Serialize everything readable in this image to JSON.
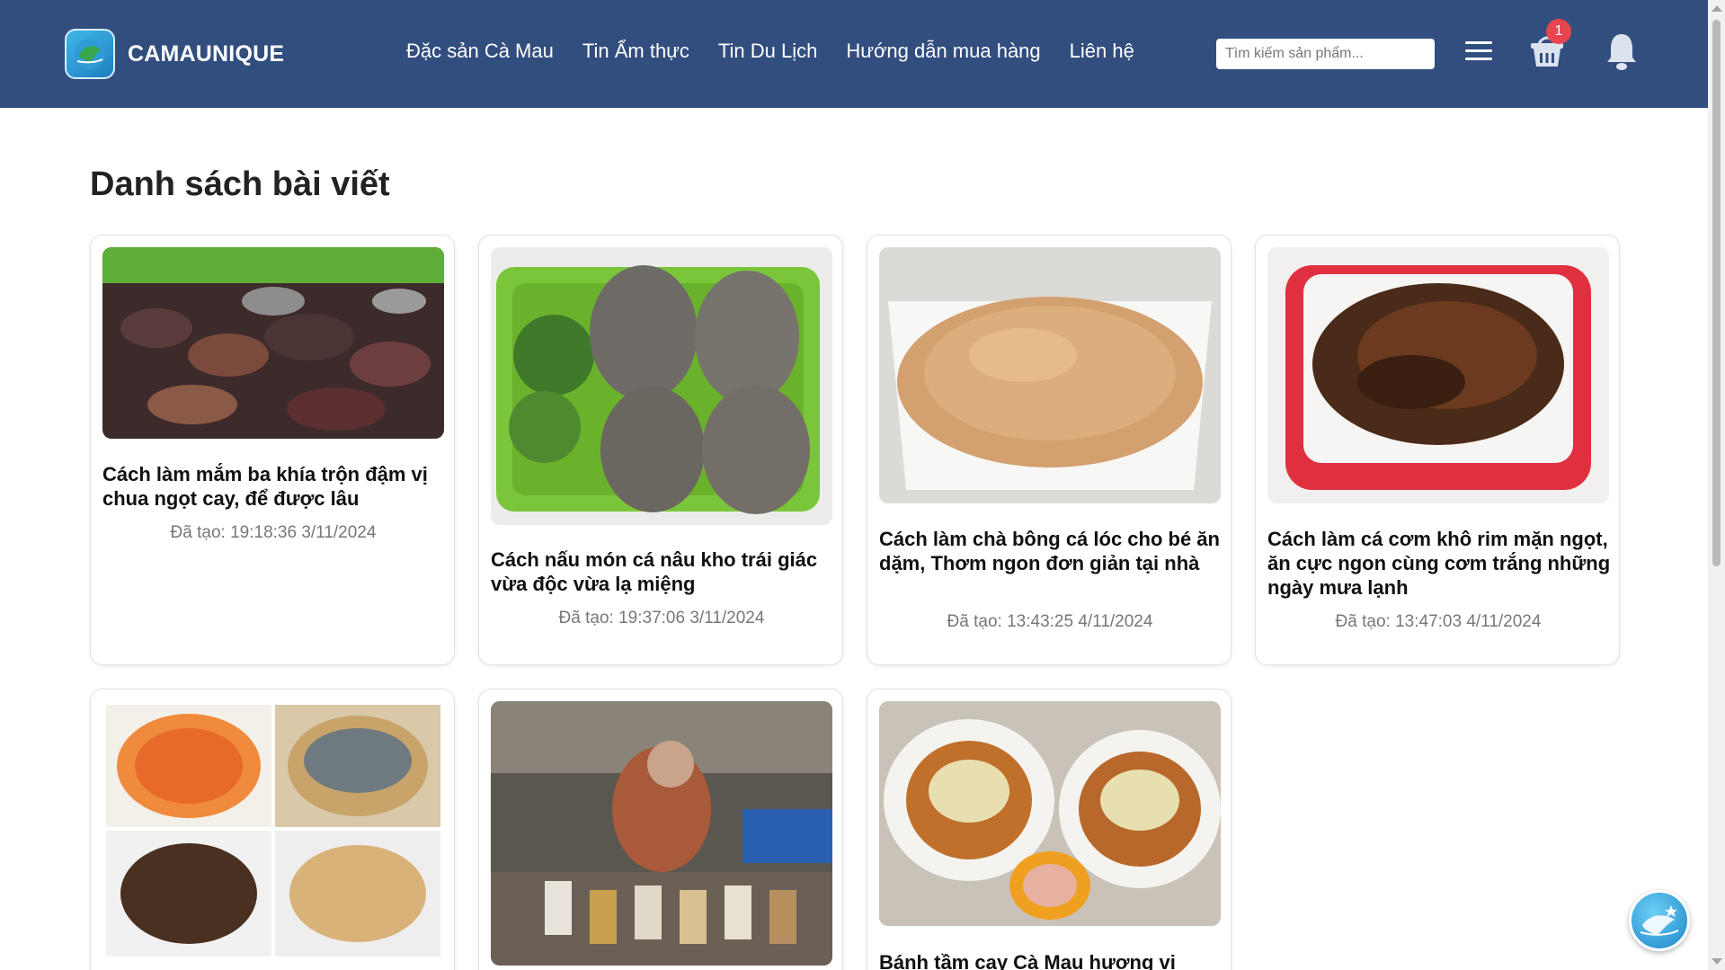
{
  "header": {
    "brand_name": "CAMAUNIQUE",
    "nav": [
      "Đặc sản Cà Mau",
      "Tin Ẩm thực",
      "Tin Du Lịch",
      "Hướng dẫn mua hàng",
      "Liên hệ"
    ],
    "search_placeholder": "Tìm kiếm sản phẩm...",
    "cart_count": "1",
    "icons": {
      "menu": "menu-icon",
      "cart": "basket-icon",
      "bell": "bell-icon"
    }
  },
  "page_title": "Danh sách bài viết",
  "posts": [
    {
      "title": "Cách làm mắm ba khía trộn đậm vị chua ngọt cay, để được lâu",
      "date": "Đã tạo: 19:18:36 3/11/2024"
    },
    {
      "title": "Cách nấu món cá nâu kho trái giác vừa độc vừa lạ miệng",
      "date": "Đã tạo: 19:37:06 3/11/2024"
    },
    {
      "title": "Cách làm chà bông cá lóc cho bé ăn dặm, Thơm ngon đơn giản tại nhà",
      "date": "Đã tạo: 13:43:25 4/11/2024"
    },
    {
      "title": "Cách làm cá cơm khô rim mặn ngọt, ăn cực ngon cùng cơm trắng những ngày mưa lạnh",
      "date": "Đã tạo: 13:47:03 4/11/2024"
    },
    {
      "title": "",
      "date": ""
    },
    {
      "title": "",
      "date": ""
    },
    {
      "title": "Bánh tầm cay Cà Mau hương vị",
      "date": ""
    }
  ],
  "colors": {
    "header_bg": "#324e7f",
    "badge": "#e8454f"
  }
}
